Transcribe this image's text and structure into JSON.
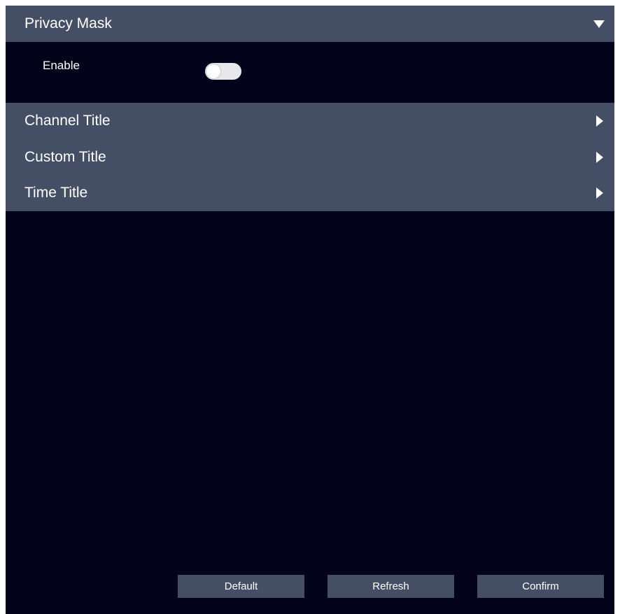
{
  "privacy_mask": {
    "title": "Privacy Mask",
    "expanded": true,
    "enable_label": "Enable",
    "enabled": false
  },
  "sections": [
    {
      "title": "Channel Title",
      "expanded": false
    },
    {
      "title": "Custom Title",
      "expanded": false
    },
    {
      "title": "Time Title",
      "expanded": false
    }
  ],
  "buttons": {
    "default_label": "Default",
    "refresh_label": "Refresh",
    "confirm_label": "Confirm"
  },
  "colors": {
    "background": "#02031a",
    "header": "#444f66",
    "text": "#ffffff",
    "toggle_off": "#e8e8ec"
  },
  "icons": {
    "expanded": "caret-down-icon",
    "collapsed": "caret-right-icon"
  }
}
